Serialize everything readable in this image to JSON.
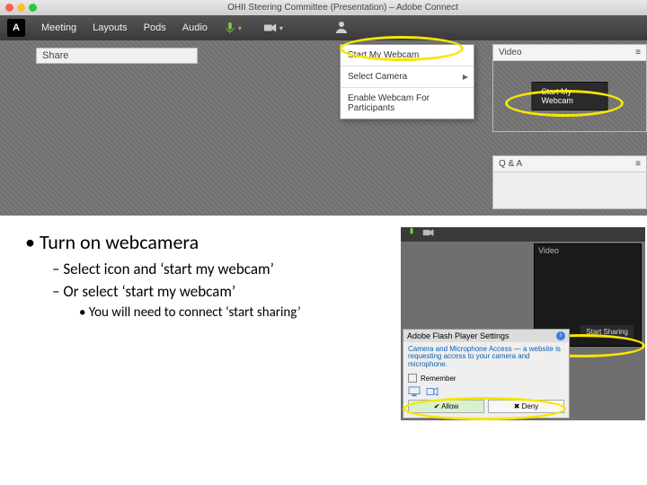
{
  "titlebar": {
    "title": "OHII Steering Committee (Presentation) – Adobe Connect"
  },
  "menubar": {
    "items": [
      "Meeting",
      "Layouts",
      "Pods",
      "Audio"
    ]
  },
  "share": {
    "label": "Share"
  },
  "dropdown": {
    "start": "Start My Webcam",
    "select": "Select Camera",
    "enable": "Enable Webcam For Participants"
  },
  "pods": {
    "video": {
      "title": "Video",
      "button": "Start My Webcam"
    },
    "qa": {
      "title": "Q & A"
    }
  },
  "instructions": {
    "b1": "Turn on webcamera",
    "b2a": "Select icon and ‘start my webcam’",
    "b2b": "Or select ‘start my webcam’",
    "b3": "You will need to connect ‘start sharing’"
  },
  "lr": {
    "video": "Video",
    "start_sharing": "Start Sharing"
  },
  "flash": {
    "title": "Adobe Flash Player Settings",
    "msg": "Camera and Microphone Access — a website is requesting access to your camera and microphone.",
    "remember": "Remember",
    "allow": "Allow",
    "deny": "Deny"
  }
}
